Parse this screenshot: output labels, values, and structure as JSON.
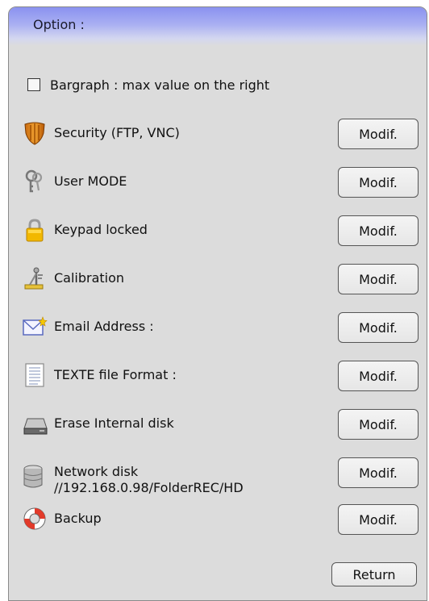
{
  "title": "Option :",
  "bargraph": {
    "label": "Bargraph : max value on the right",
    "checked": false
  },
  "options": [
    {
      "label": "Security (FTP, VNC)",
      "icon": "shield-icon",
      "button": "Modif."
    },
    {
      "label": "User MODE",
      "icon": "keys-icon",
      "button": "Modif."
    },
    {
      "label": "Keypad locked",
      "icon": "padlock-icon",
      "button": "Modif."
    },
    {
      "label": "Calibration",
      "icon": "calibration-icon",
      "button": "Modif."
    },
    {
      "label": "Email Address :",
      "icon": "email-icon",
      "button": "Modif."
    },
    {
      "label": "TEXTE file Format :",
      "icon": "text-file-icon",
      "button": "Modif."
    },
    {
      "label": "Erase Internal disk",
      "icon": "hard-disk-icon",
      "button": "Modif."
    },
    {
      "label": "Network disk",
      "sublabel": "//192.168.0.98/FolderREC/HD",
      "icon": "network-disk-icon",
      "button": "Modif."
    },
    {
      "label": "Backup",
      "icon": "lifebuoy-icon",
      "button": "Modif."
    }
  ],
  "return_label": "Return"
}
